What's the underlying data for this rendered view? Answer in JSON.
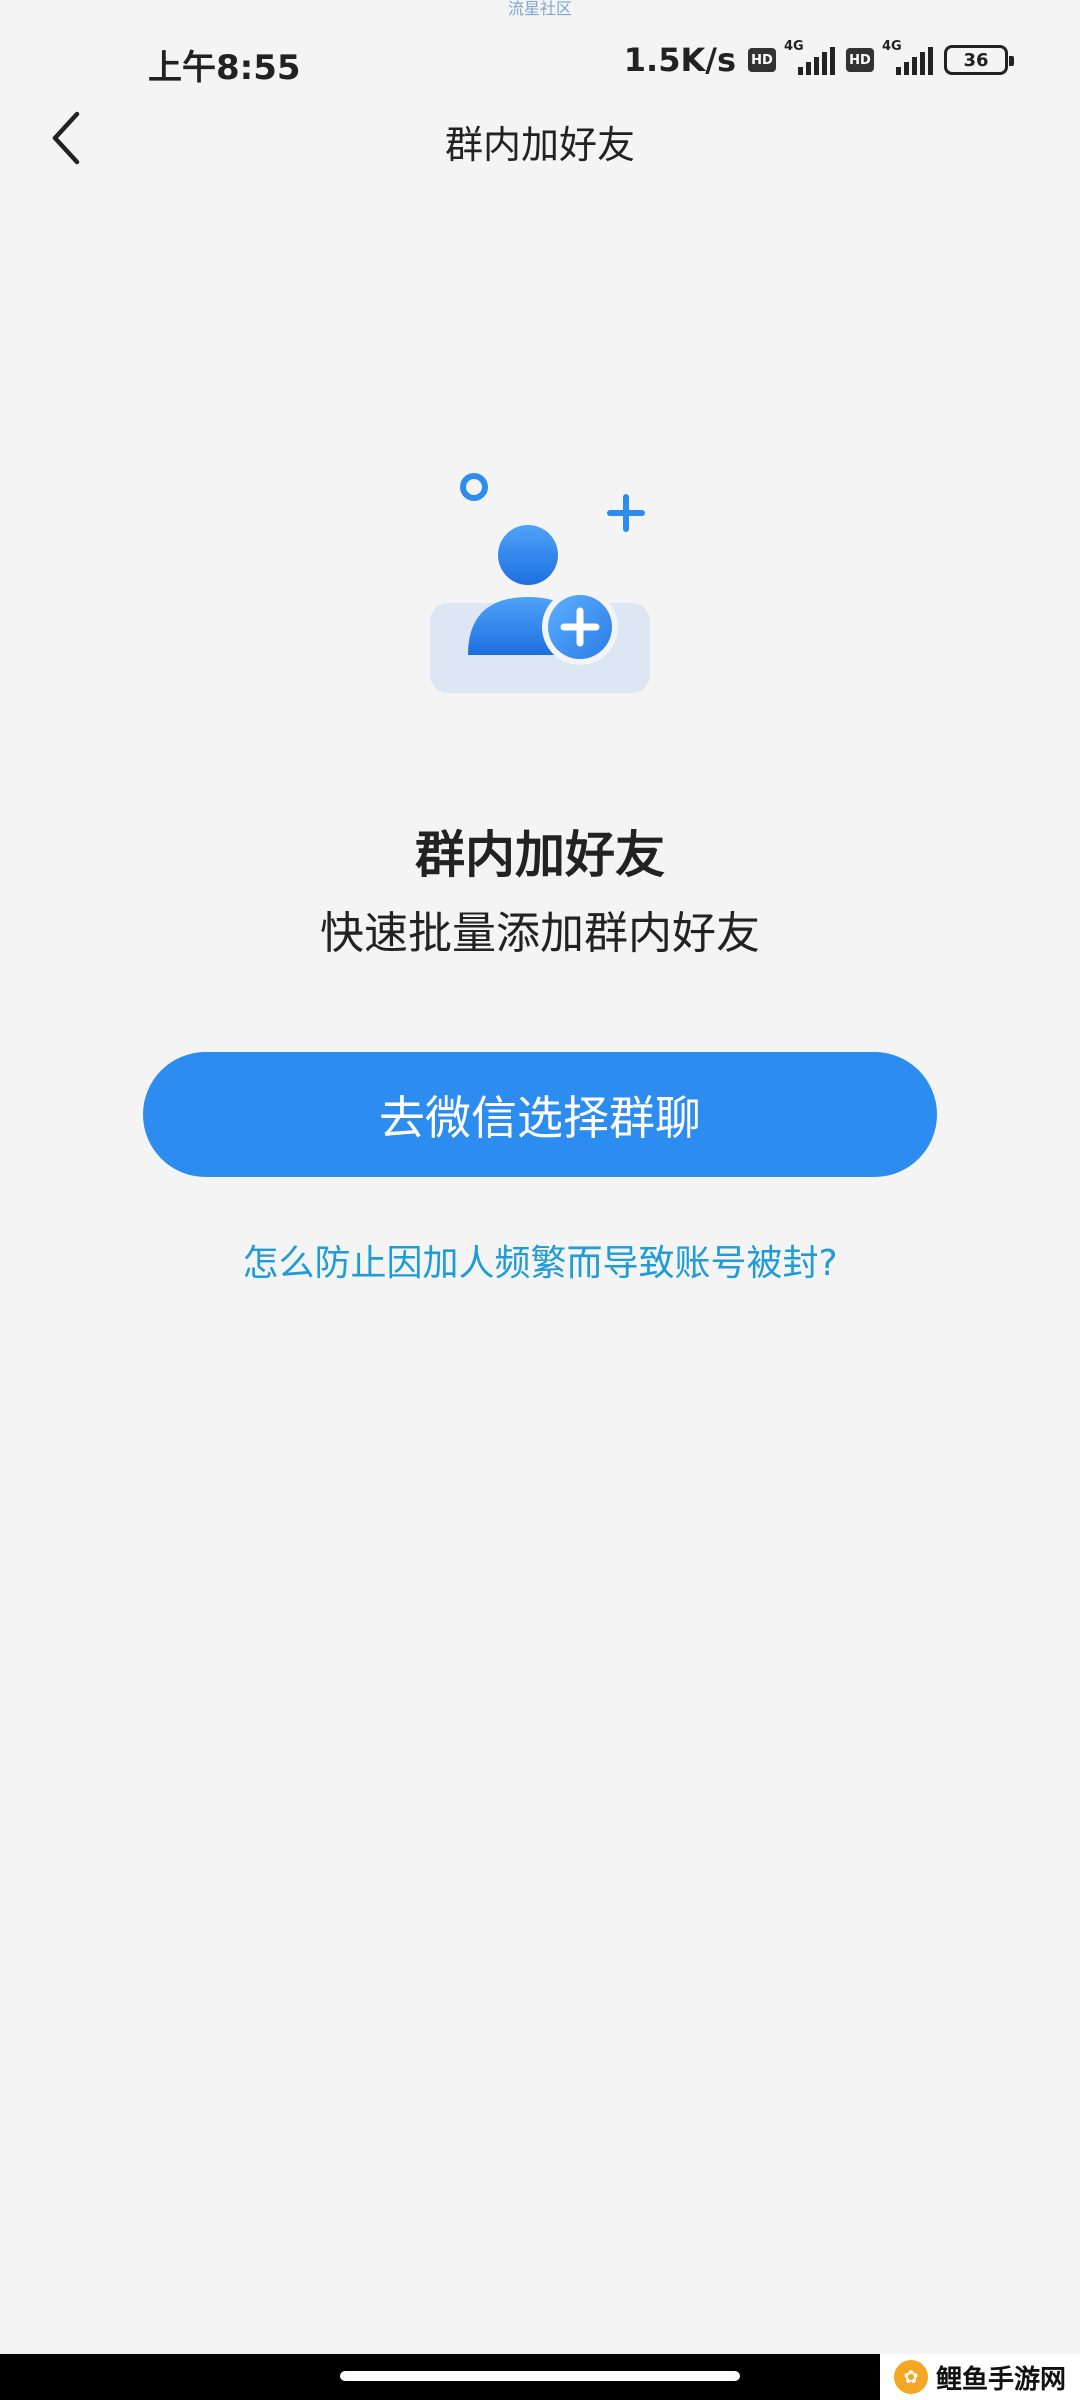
{
  "watermark_top": "流星社区",
  "status_bar": {
    "time": "上午8:55",
    "net_speed": "1.5K/s",
    "hd_label": "HD",
    "network_1": "4G",
    "network_2": "4G",
    "battery": "36"
  },
  "nav": {
    "back_icon": "chevron-left-icon",
    "title": "群内加好友"
  },
  "illustration": {
    "icon": "add-user-icon",
    "accent": "#2d8cf0"
  },
  "hero": {
    "title": "群内加好友",
    "subtitle": "快速批量添加群内好友"
  },
  "primary_button": {
    "label": "去微信选择群聊",
    "color": "#2d8cf0"
  },
  "help_link": {
    "label": "怎么防止因加人频繁而导致账号被封?",
    "color": "#1f9bd7"
  },
  "watermark_corner": {
    "text": "鲤鱼手游网"
  }
}
